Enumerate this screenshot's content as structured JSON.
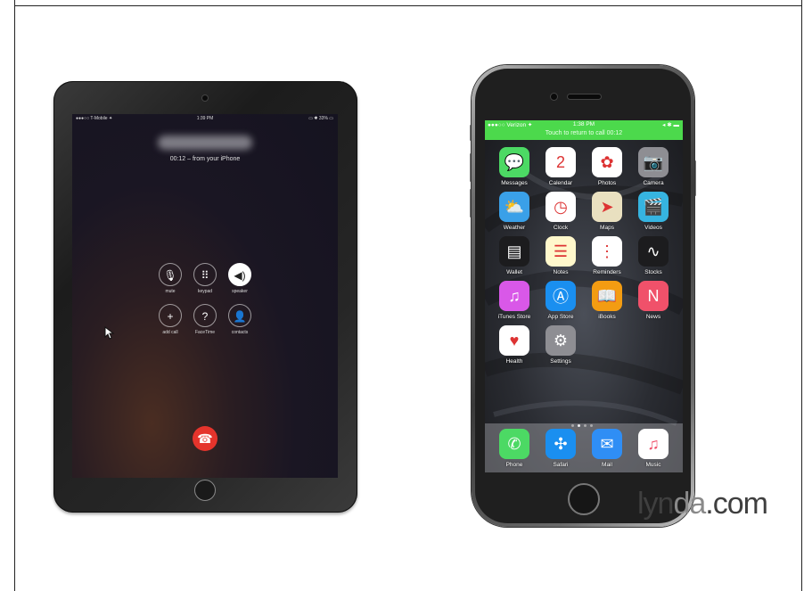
{
  "ipad": {
    "status": {
      "carrier": "●●●○○ T-Mobile ✦",
      "time": "1:39 PM",
      "right": "▭ ✱ 33% ▭"
    },
    "call_subtitle": "00:12 – from your iPhone",
    "buttons": [
      {
        "label": "mute",
        "glyph": "🎙"
      },
      {
        "label": "keypad",
        "glyph": "⠿"
      },
      {
        "label": "speaker",
        "glyph": "◀)"
      },
      {
        "label": "add call",
        "glyph": "+"
      },
      {
        "label": "FaceTime",
        "glyph": "?"
      },
      {
        "label": "contacts",
        "glyph": "👤"
      }
    ],
    "end_call_glyph": "☎"
  },
  "iphone": {
    "status": {
      "carrier": "●●●○○ Verizon ✦",
      "time": "1:38 PM",
      "right": "◂ ✱ ▬"
    },
    "touch_banner": "Touch to return to call 00:12",
    "apps": [
      {
        "name": "Messages",
        "glyph": "💬",
        "color": "#4cd964"
      },
      {
        "name": "Calendar",
        "glyph": "2",
        "color": "#ffffff"
      },
      {
        "name": "Photos",
        "glyph": "✿",
        "color": "#ffffff"
      },
      {
        "name": "Camera",
        "glyph": "📷",
        "color": "#8e8e93"
      },
      {
        "name": "Weather",
        "glyph": "⛅",
        "color": "#3aa0e8"
      },
      {
        "name": "Clock",
        "glyph": "◷",
        "color": "#ffffff"
      },
      {
        "name": "Maps",
        "glyph": "➤",
        "color": "#e9e0c0"
      },
      {
        "name": "Videos",
        "glyph": "🎬",
        "color": "#36b4e0"
      },
      {
        "name": "Wallet",
        "glyph": "▤",
        "color": "#1c1c1e"
      },
      {
        "name": "Notes",
        "glyph": "☰",
        "color": "#fff8cc"
      },
      {
        "name": "Reminders",
        "glyph": "⋮",
        "color": "#ffffff"
      },
      {
        "name": "Stocks",
        "glyph": "∿",
        "color": "#1c1c1e"
      },
      {
        "name": "iTunes Store",
        "glyph": "♫",
        "color": "#d958e8"
      },
      {
        "name": "App Store",
        "glyph": "Ⓐ",
        "color": "#1a8ff0"
      },
      {
        "name": "iBooks",
        "glyph": "📖",
        "color": "#f39c12"
      },
      {
        "name": "News",
        "glyph": "N",
        "color": "#f0516a"
      },
      {
        "name": "Health",
        "glyph": "♥",
        "color": "#ffffff"
      },
      {
        "name": "Settings",
        "glyph": "⚙",
        "color": "#8e8e93"
      }
    ],
    "dock": [
      {
        "name": "Phone",
        "glyph": "✆",
        "color": "#4cd964"
      },
      {
        "name": "Safari",
        "glyph": "✣",
        "color": "#1a8ff0"
      },
      {
        "name": "Mail",
        "glyph": "✉",
        "color": "#2f8ef5"
      },
      {
        "name": "Music",
        "glyph": "♫",
        "color": "#ffffff"
      }
    ]
  },
  "watermark": {
    "part1": "lyn",
    "part2": "da",
    "part3": ".com"
  }
}
